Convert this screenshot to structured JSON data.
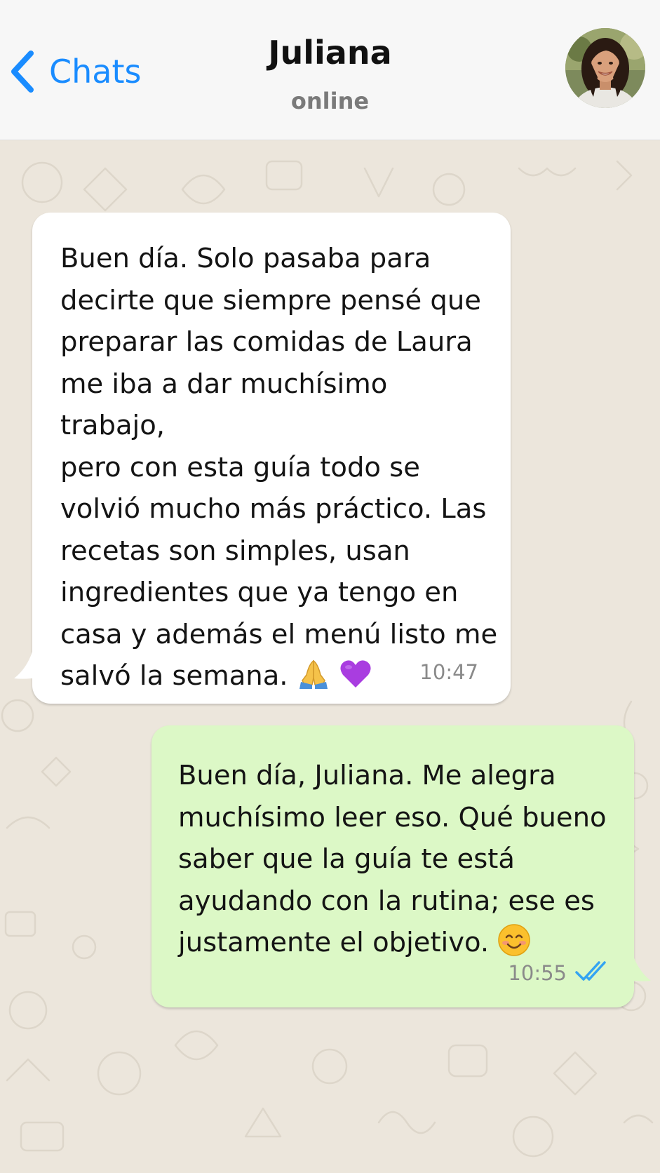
{
  "header": {
    "back_label": "Chats",
    "contact_name": "Juliana",
    "contact_status": "online"
  },
  "messages": [
    {
      "direction": "incoming",
      "text": "Buen día. Solo pasaba para\ndecirte que siempre pensé que\npreparar las comidas de Laura\nme iba a dar muchísimo trabajo,\npero con esta guía todo se\nvolvió mucho más práctico. Las\nrecetas son simples, usan\ningredientes que ya tengo en\ncasa y además el menú listo me\nsalvó la semana.",
      "emojis": [
        "folded-hands-emoji",
        "purple-heart-emoji"
      ],
      "time": "10:47"
    },
    {
      "direction": "outgoing",
      "text": "Buen día, Juliana. Me alegra\nmuchísimo leer eso. Qué bueno\nsaber que la guía te está\nayudando con la rutina; ese es\njustamente el objetivo.",
      "emojis": [
        "smiling-face-emoji"
      ],
      "time": "10:55",
      "status": "read"
    }
  ],
  "colors": {
    "accent": "#1a8cff",
    "incoming_bubble": "#ffffff",
    "outgoing_bubble": "#dcf8c6",
    "chat_background": "#ece6dc",
    "read_ticks": "#34a4f2"
  }
}
